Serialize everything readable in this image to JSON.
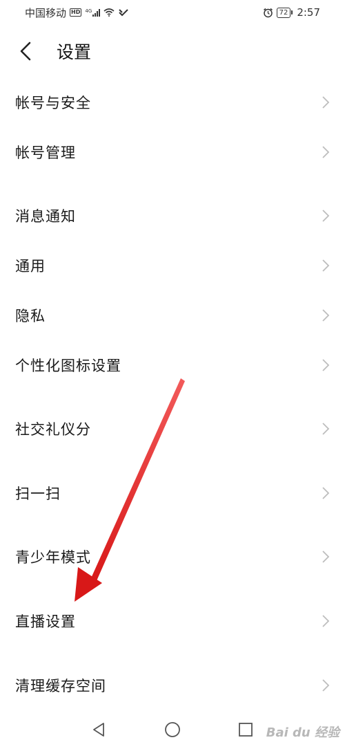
{
  "status_bar": {
    "carrier": "中国移动",
    "hd": "HD",
    "network": "4G",
    "battery": "72",
    "time": "2:57"
  },
  "header": {
    "title": "设置"
  },
  "settings": {
    "items": [
      {
        "label": "帐号与安全"
      },
      {
        "label": "帐号管理"
      },
      {
        "label": "消息通知"
      },
      {
        "label": "通用"
      },
      {
        "label": "隐私"
      },
      {
        "label": "个性化图标设置"
      },
      {
        "label": "社交礼仪分"
      },
      {
        "label": "扫一扫"
      },
      {
        "label": "青少年模式"
      },
      {
        "label": "直播设置"
      },
      {
        "label": "清理缓存空间"
      }
    ]
  },
  "annotation": {
    "arrow_color": "#e02020"
  },
  "watermark": {
    "text": "Bai du 经验"
  },
  "icons": {
    "back": "chevron-left-icon",
    "item_arrow": "chevron-right-icon",
    "nav_back": "triangle-back-icon",
    "nav_home": "circle-home-icon",
    "nav_recent": "square-recent-icon",
    "alarm": "alarm-icon",
    "wifi": "wifi-icon",
    "signal": "signal-icon"
  }
}
